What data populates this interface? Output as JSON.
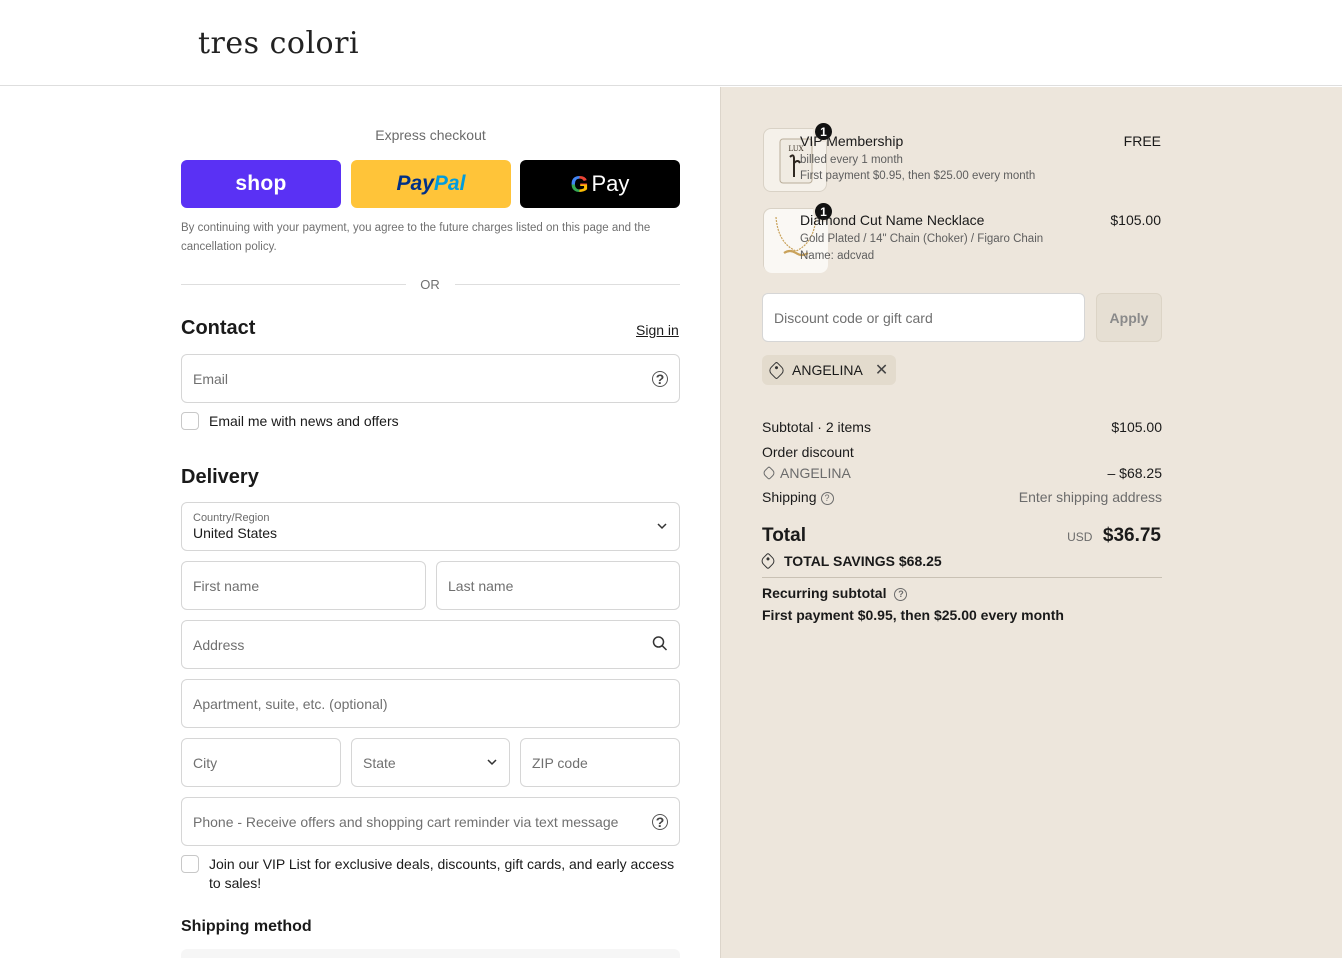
{
  "brand": {
    "logo_text": "tres colori"
  },
  "express": {
    "title": "Express checkout",
    "shop_label": "shop",
    "paypal_label_1": "Pay",
    "paypal_label_2": "Pal",
    "gpay_g": "G",
    "gpay_label": "Pay",
    "consent_text": "By continuing with your payment, you agree to the future charges listed on this page and the cancellation policy.",
    "or_text": "OR"
  },
  "contact": {
    "title": "Contact",
    "sign_in": "Sign in",
    "email_placeholder": "Email",
    "news_checkbox_label": "Email me with news and offers"
  },
  "delivery": {
    "title": "Delivery",
    "country_label": "Country/Region",
    "country_value": "United States",
    "first_name": "First name",
    "last_name": "Last name",
    "address": "Address",
    "apartment": "Apartment, suite, etc. (optional)",
    "city": "City",
    "state": "State",
    "zip": "ZIP code",
    "phone": "Phone - Receive offers and shopping cart reminder via text message",
    "vip_checkbox_label": "Join our VIP List for exclusive deals, discounts, gift cards, and early access to sales!"
  },
  "shipping_method": {
    "title": "Shipping method"
  },
  "cart": {
    "items": [
      {
        "name": "VIP Membership",
        "qty": "1",
        "sub_1": "billed every 1 month",
        "sub_2": "First payment $0.95, then $25.00 every month",
        "price": "FREE",
        "thumb_text": "LUX"
      },
      {
        "name": "Diamond Cut Name Necklace",
        "qty": "1",
        "sub_1": "Gold Plated / 14\" Chain (Choker) / Figaro Chain",
        "sub_2": "Name: adcvad",
        "price": "$105.00"
      }
    ],
    "discount_placeholder": "Discount code or gift card",
    "apply_label": "Apply",
    "applied_code": "ANGELINA",
    "subtotal_label": "Subtotal · 2 items",
    "subtotal_value": "$105.00",
    "order_discount_label": "Order discount",
    "order_discount_code": "ANGELINA",
    "order_discount_value": "– $68.25",
    "shipping_label": "Shipping",
    "shipping_value": "Enter shipping address",
    "total_label": "Total",
    "total_currency": "USD",
    "total_value": "$36.75",
    "savings_label": "TOTAL SAVINGS",
    "savings_value": "$68.25",
    "recurring_label": "Recurring subtotal",
    "recurring_detail": "First payment $0.95, then $25.00 every month"
  },
  "colors": {
    "shop_purple": "#5a31f4",
    "paypal_yellow": "#ffc439",
    "summary_bg": "#ede6dc"
  }
}
